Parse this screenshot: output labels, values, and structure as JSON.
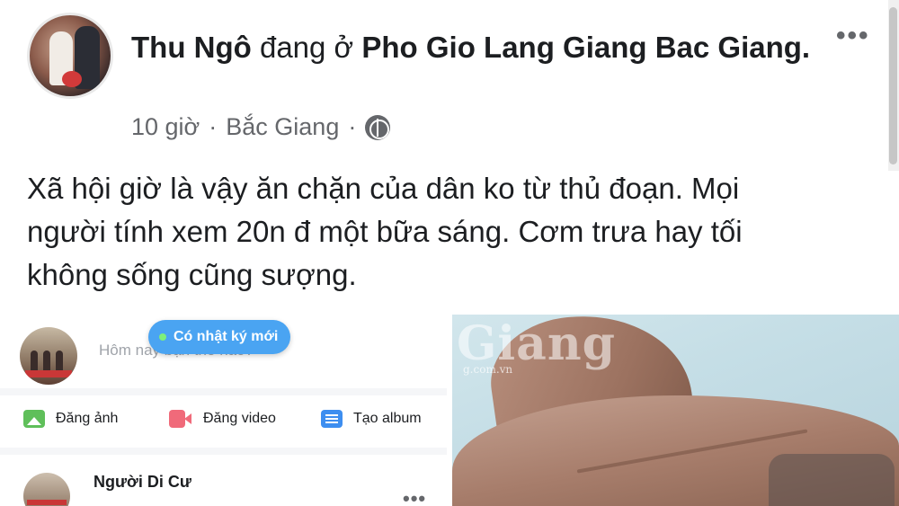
{
  "post": {
    "author": "Thu Ngô",
    "location_prefix": "đang ở",
    "location": "Pho Gio Lang Giang Bac Giang.",
    "time": "10 giờ",
    "separator": "·",
    "place": "Bắc Giang",
    "privacy_icon": "globe-icon",
    "menu_icon": "more-options-icon",
    "text": "Xã hội giờ  là vậy ăn chặn của dân ko từ thủ đoạn. Mọi\nngười tính xem 20n đ một bữa sáng. Cơm trưa hay tối\nkhông sống cũng sượng."
  },
  "embedded_screenshot": {
    "composer_placeholder": "Hôm nay bạn thế nào?",
    "new_diary_pill": "Có nhật ký mới",
    "actions": [
      {
        "label": "Đăng ảnh",
        "icon": "photo-icon"
      },
      {
        "label": "Đăng video",
        "icon": "video-icon"
      },
      {
        "label": "Tạo album",
        "icon": "album-icon"
      }
    ],
    "feed_item_name": "Người Di Cư",
    "feed_item_menu": "•••"
  },
  "photo": {
    "watermark": "Giang",
    "watermark_url": "g.com.vn",
    "description_icon": "hand-photo"
  },
  "colors": {
    "pill_blue": "#4aa4f2",
    "text_primary": "#1c1e21",
    "text_secondary": "#65676b"
  }
}
